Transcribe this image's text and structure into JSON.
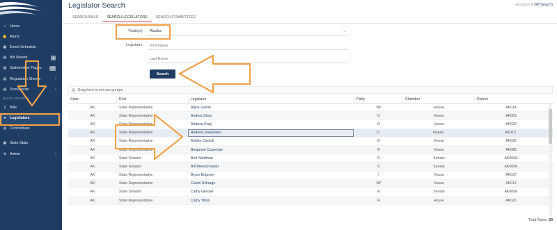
{
  "sidebar": {
    "items": [
      {
        "label": "Home",
        "icon": "home-icon",
        "glyph": "⌂"
      },
      {
        "label": "Alerts",
        "icon": "bell-icon",
        "glyph": "🔔"
      },
      {
        "label": "Event Schedule",
        "icon": "calendar-icon",
        "glyph": "▦"
      },
      {
        "label": "Bill Sheets",
        "icon": "sheet-icon",
        "glyph": "▤",
        "badge": "4"
      },
      {
        "label": "Stakeholder Pages",
        "icon": "sheet-icon",
        "glyph": "▤",
        "badge": "27"
      },
      {
        "label": "Regulation Sheets",
        "icon": "sheet-icon",
        "glyph": "▤",
        "chevron": "‹"
      },
      {
        "label": "Scorecards",
        "icon": "scorecard-icon",
        "glyph": "▤",
        "chevron": "‹"
      }
    ],
    "section_label": "QUICK SEARCH",
    "quick": [
      {
        "label": "Bills",
        "icon": "document-icon",
        "glyph": "▯"
      },
      {
        "label": "Legislators",
        "icon": "person-icon",
        "glyph": "●"
      },
      {
        "label": "Committees",
        "icon": "group-icon",
        "glyph": "◍"
      },
      {
        "label": "State Stats",
        "icon": "stats-icon",
        "glyph": "▦"
      },
      {
        "label": "Admin",
        "icon": "gear-icon",
        "glyph": "⚙",
        "chevron": "‹"
      }
    ]
  },
  "header": {
    "title": "Legislator Search",
    "breadcrumb_account": "Account",
    "breadcrumb_sep": " > ",
    "breadcrumb_current": "Bill Search"
  },
  "tabs": [
    "SEARCH BILLS",
    "SEARCH LEGISLATORS",
    "SEARCH COMMITTEES"
  ],
  "form": {
    "state_label": "*State(s):",
    "state_value": "Alaska",
    "legislator_label": "Legislator:",
    "first_name_placeholder": "First Name",
    "last_name_placeholder": "Last Name",
    "search_label": "Search"
  },
  "grid": {
    "group_hint": "Drag here to set row groups",
    "columns": [
      "State",
      "Role",
      "Legislator",
      "Party",
      "Chamber",
      "District"
    ],
    "rows": [
      {
        "state": "AK",
        "role": "State Representative",
        "legislator": "Alyse Galvin",
        "party": "NP",
        "chamber": "House",
        "district": "AK014"
      },
      {
        "state": "AK",
        "role": "State Representative",
        "legislator": "Andrea Story",
        "party": "D",
        "chamber": "House",
        "district": "AK003"
      },
      {
        "state": "AK",
        "role": "State Representative",
        "legislator": "Andrew Gray",
        "party": "D",
        "chamber": "House",
        "district": "AK020"
      },
      {
        "state": "AK",
        "role": "State Representative",
        "legislator": "Andrew Josephson",
        "party": "D",
        "chamber": "House",
        "district": "AK013"
      },
      {
        "state": "AK",
        "role": "State Representative",
        "legislator": "Ashley Carrick",
        "party": "D",
        "chamber": "House",
        "district": "AK035"
      },
      {
        "state": "AK",
        "role": "State Representative",
        "legislator": "Benjamin Carpenter",
        "party": "R",
        "chamber": "House",
        "district": "AK008"
      },
      {
        "state": "AK",
        "role": "State Senator",
        "legislator": "Bert Stedman",
        "party": "R",
        "chamber": "Senate",
        "district": "AK000A"
      },
      {
        "state": "AK",
        "role": "State Senator",
        "legislator": "Bill Wielechowski",
        "party": "D",
        "chamber": "Senate",
        "district": "AK000K"
      },
      {
        "state": "AK",
        "role": "State Representative",
        "legislator": "Bryce Edgmon",
        "party": "I",
        "chamber": "House",
        "district": "AK037"
      },
      {
        "state": "AK",
        "role": "State Representative",
        "legislator": "Calvin Schrage",
        "party": "NP",
        "chamber": "House",
        "district": "AK012"
      },
      {
        "state": "AK",
        "role": "State Senator",
        "legislator": "Cathy Giessel",
        "party": "R",
        "chamber": "Senate",
        "district": "AK000E"
      },
      {
        "state": "AK",
        "role": "State Representative",
        "legislator": "Cathy Tilton",
        "party": "R",
        "chamber": "House",
        "district": "AK026"
      }
    ],
    "total_label": "Total Rows:",
    "total_value": "60"
  },
  "colors": {
    "sidebar": "#1f3d63",
    "accent_arrow": "#f0a24a",
    "button": "#1f3d63"
  }
}
